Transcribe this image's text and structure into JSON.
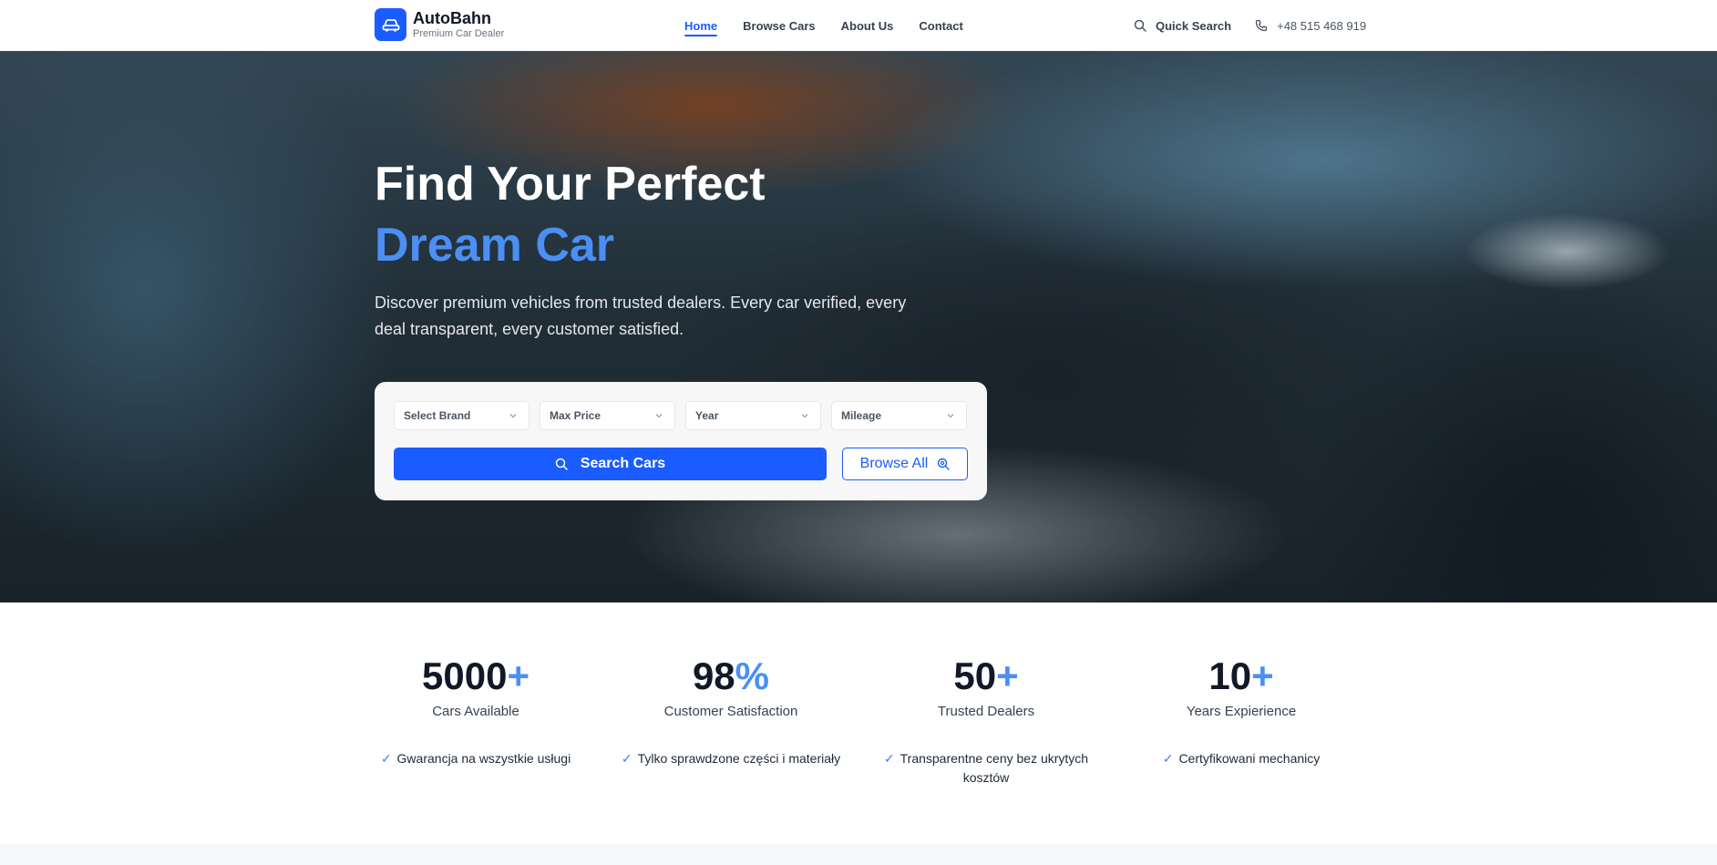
{
  "brand": {
    "name": "AutoBahn",
    "tagline": "Premium Car Dealer",
    "color": "#1a5cff"
  },
  "nav": {
    "items": [
      {
        "label": "Home",
        "active": true
      },
      {
        "label": "Browse Cars",
        "active": false
      },
      {
        "label": "About Us",
        "active": false
      },
      {
        "label": "Contact",
        "active": false
      }
    ],
    "quick_search": "Quick Search",
    "phone": "+48 515 468 919"
  },
  "hero": {
    "title_line1": "Find Your Perfect",
    "title_line2": "Dream Car",
    "subtitle": "Discover premium vehicles from trusted dealers. Every car verified, every deal transparent, every customer satisfied."
  },
  "search": {
    "filters": [
      "Select Brand",
      "Max Price",
      "Year",
      "Mileage"
    ],
    "search_button": "Search Cars",
    "browse_button": "Browse All"
  },
  "stats": [
    {
      "value": "5000",
      "suffix": "+",
      "label": "Cars Available"
    },
    {
      "value": "98",
      "suffix": "%",
      "label": "Customer Satisfaction"
    },
    {
      "value": "50",
      "suffix": "+",
      "label": "Trusted Dealers"
    },
    {
      "value": "10",
      "suffix": "+",
      "label": "Years Expierience"
    }
  ],
  "features": [
    "Gwarancja na wszystkie usługi",
    "Tylko sprawdzone części i materiały",
    "Transparentne ceny bez ukrytych kosztów",
    "Certyfikowani mechanicy"
  ],
  "check_mark": "✓"
}
